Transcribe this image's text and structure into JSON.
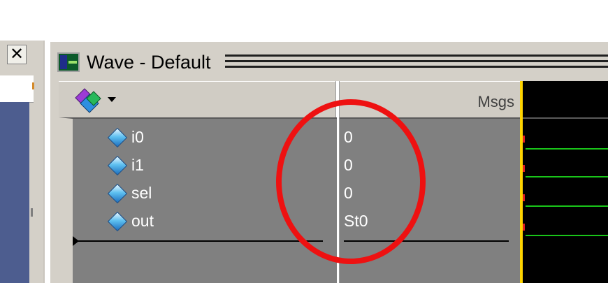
{
  "window": {
    "title": "Wave - Default"
  },
  "left_pane": {
    "close_glyph": "✕"
  },
  "toolbar": {
    "column_header": "Msgs",
    "dropdown_icon": "chevron-down-icon"
  },
  "signals": [
    {
      "name": "i0",
      "value": "0"
    },
    {
      "name": "i1",
      "value": "0"
    },
    {
      "name": "sel",
      "value": "0"
    },
    {
      "name": "out",
      "value": "St0"
    }
  ],
  "colors": {
    "annotation": "#ee1111",
    "trace": "#19c419",
    "cursor": "#ffd400",
    "pane_bg": "#808080"
  }
}
